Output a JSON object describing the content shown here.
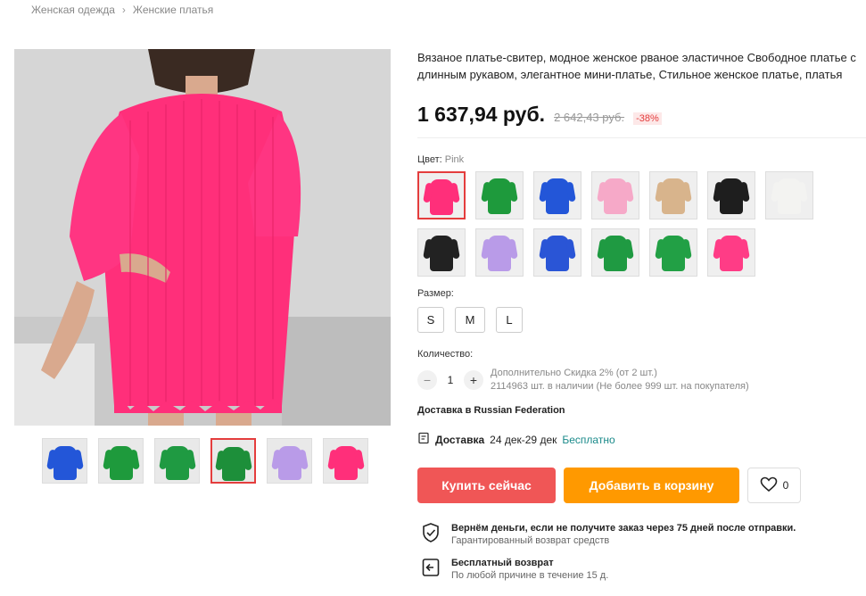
{
  "breadcrumb": {
    "items": [
      "Женская одежда",
      "Женские платья"
    ],
    "separator": "›"
  },
  "product": {
    "title": "Вязаное платье-свитер, модное женское рваное эластичное Свободное платье с длинным рукавом, элегантное мини-платье, Стильное женское платье, платья",
    "price": "1 637,94 руб.",
    "old_price": "2 642,43 руб.",
    "discount": "-38%"
  },
  "color": {
    "label": "Цвет:",
    "selected": "Pink",
    "swatches_row1": [
      {
        "name": "pink",
        "color": "#ff2f7a"
      },
      {
        "name": "green",
        "color": "#1e9a3c"
      },
      {
        "name": "blue",
        "color": "#2356d8"
      },
      {
        "name": "light-pink",
        "color": "#f6a9c8"
      },
      {
        "name": "beige",
        "color": "#d8b48c"
      },
      {
        "name": "black",
        "color": "#1e1e1e"
      },
      {
        "name": "white",
        "color": "#f3f3f1"
      }
    ],
    "swatches_row2": [
      {
        "name": "black",
        "color": "#222222"
      },
      {
        "name": "lilac",
        "color": "#b99be8"
      },
      {
        "name": "blue",
        "color": "#2a55d6"
      },
      {
        "name": "green",
        "color": "#1f9a42"
      },
      {
        "name": "green-2",
        "color": "#22a045"
      },
      {
        "name": "pink",
        "color": "#ff3c86"
      }
    ]
  },
  "size": {
    "label": "Размер:",
    "options": [
      "S",
      "M",
      "L"
    ]
  },
  "quantity": {
    "label": "Количество:",
    "minus": "−",
    "plus": "+",
    "value": "1",
    "discount_note": "Дополнительно Скидка 2% (от 2 шт.)",
    "stock_note": "2114963 шт. в наличии (Не более 999 шт. на покупателя)"
  },
  "delivery": {
    "to_label": "Доставка в Russian Federation",
    "label": "Доставка",
    "dates": "24 дек-29 дек",
    "price": "Бесплатно"
  },
  "actions": {
    "buy_now": "Купить сейчас",
    "add_to_cart": "Добавить в корзину",
    "wishlist_count": "0"
  },
  "guarantees": [
    {
      "title": "Вернём деньги, если не получите заказ через 75 дней после отправки.",
      "subtitle": "Гарантированный возврат средств"
    },
    {
      "title": "Бесплатный возврат",
      "subtitle": "По любой причине в течение 15 д."
    }
  ],
  "gallery": {
    "thumbnails": [
      {
        "color": "#2356d8"
      },
      {
        "color": "#1e9a3c"
      },
      {
        "color": "#1f9a42"
      },
      {
        "color": "#1d8f3a"
      },
      {
        "color": "#b99be8"
      },
      {
        "color": "#ff2f7a"
      }
    ],
    "active_index": 3
  },
  "colors": {
    "accent_red": "#e43d3d",
    "buy_button": "#f05656",
    "cart_button": "#ff9900",
    "free_text": "#1a8a8a"
  }
}
